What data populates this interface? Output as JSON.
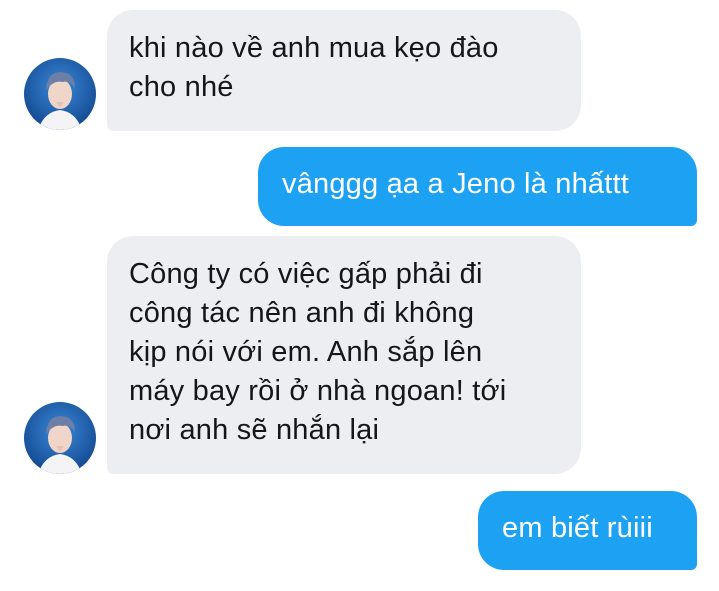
{
  "conversation": {
    "messages": [
      {
        "sender": "other",
        "text": "khi nào về anh mua kẹo đào\ncho nhé"
      },
      {
        "sender": "me",
        "text": "vânggg ạa a Jeno là nhấttt"
      },
      {
        "sender": "other",
        "text": "Công ty có việc gấp phải đi\ncông tác nên anh đi không\nkịp nói với em. Anh sắp lên\nmáy bay rồi ở nhà ngoan! tới\nnơi anh sẽ nhắn lại"
      },
      {
        "sender": "me",
        "text": "em biết rùiii"
      }
    ]
  },
  "colors": {
    "incoming_bubble": "#eceef1",
    "outgoing_bubble": "#1da1f2",
    "incoming_text": "#14171a",
    "outgoing_text": "#ffffff"
  },
  "icons": {
    "avatar": "contact-avatar-photo"
  }
}
